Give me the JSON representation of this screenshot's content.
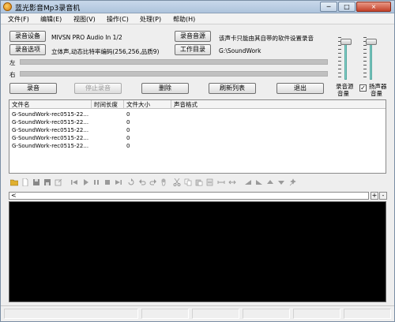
{
  "window": {
    "title": "蓝光影音Mp3录音机",
    "min_label": "─",
    "max_label": "□",
    "close_label": "×"
  },
  "menu": [
    "文件(F)",
    "编辑(E)",
    "视图(V)",
    "操作(C)",
    "处理(P)",
    "帮助(H)"
  ],
  "settings": {
    "device_button": "录音设备",
    "device_value": "MIVSN PRO Audio In 1/2",
    "options_button": "录音选项",
    "options_value": "立体声,动态比特率编码(256,256,品质9)",
    "source_button": "录音音源",
    "source_note": "该声卡只能由其自带的软件设置录音",
    "workdir_button": "工作目录",
    "workdir_value": "G:\\SoundWork"
  },
  "levels": {
    "left_label": "左",
    "right_label": "右",
    "left_value": 0,
    "right_value": 0
  },
  "actions": {
    "record": "录音",
    "stop": "停止录音",
    "delete": "删除",
    "refresh": "刷新列表",
    "exit": "退出"
  },
  "volume": {
    "record_label_1": "录音源",
    "record_label_2": "音量",
    "speaker_label_1": "扬声器",
    "speaker_label_2": "音量",
    "speaker_checked": true,
    "check_mark": "✓"
  },
  "file_list": {
    "columns": [
      "文件名",
      "时间长度",
      "文件大小",
      "声音格式"
    ],
    "rows": [
      {
        "name": "G-SoundWork-rec0515-22...",
        "duration": "",
        "size": "0",
        "format": ""
      },
      {
        "name": "G-SoundWork-rec0515-22...",
        "duration": "",
        "size": "0",
        "format": ""
      },
      {
        "name": "G-SoundWork-rec0515-22...",
        "duration": "",
        "size": "0",
        "format": ""
      },
      {
        "name": "G-SoundWork-rec0515-22...",
        "duration": "",
        "size": "0",
        "format": ""
      },
      {
        "name": "G-SoundWork-rec0515-22...",
        "duration": "",
        "size": "0",
        "format": ""
      }
    ]
  },
  "timeline": {
    "scroll_left": "<",
    "zoom_in": "+",
    "zoom_out": "-"
  }
}
